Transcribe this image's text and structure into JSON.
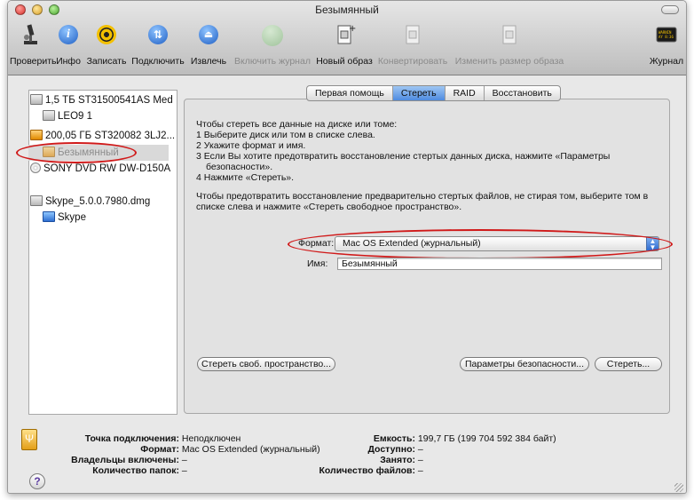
{
  "window": {
    "title": "Безымянный"
  },
  "toolbar": {
    "verify": "Проверить",
    "info": "Инфо",
    "burn": "Записать",
    "mount": "Подключить",
    "eject": "Извлечь",
    "enable_journal": "Включить журнал",
    "new_image": "Новый образ",
    "convert": "Конвертировать",
    "resize_image": "Изменить размер образа",
    "log": "Журнал"
  },
  "sidebar": {
    "items": [
      {
        "label": "1,5 ТБ ST31500541AS Med"
      },
      {
        "label": "LEO9 1"
      },
      {
        "label": "200,05 ГБ ST320082 3LJ2..."
      },
      {
        "label": "Безымянный"
      },
      {
        "label": "SONY DVD RW DW-D150A"
      },
      {
        "label": "Skype_5.0.0.7980.dmg"
      },
      {
        "label": "Skype"
      }
    ]
  },
  "tabs": [
    "Первая помощь",
    "Стереть",
    "RAID",
    "Восстановить"
  ],
  "instructions": {
    "line1": "Чтобы стереть все данные на диске или томе:",
    "line2": "1  Выберите диск или том в списке слева.",
    "line3": "2  Укажите формат и имя.",
    "line4": "3  Если Вы хотите предотвратить восстановление стертых данных диска, нажмите «Параметры",
    "line5": "безопасности».",
    "line6": "4  Нажмите «Стереть».",
    "para2_line1": "Чтобы предотвратить восстановление предварительно стертых файлов, не стирая том, выберите том в",
    "para2_line2": "списке слева и нажмите «Стереть свободное пространство»."
  },
  "form": {
    "format_label": "Формат:",
    "format_value": "Mac OS Extended (журнальный)",
    "name_label": "Имя:",
    "name_value": "Безымянный"
  },
  "buttons": {
    "erase_free": "Стереть своб. пространство...",
    "security": "Параметры безопасности...",
    "erase": "Стереть..."
  },
  "info": {
    "mount_label": "Точка подключения:",
    "mount_value": "Неподключен",
    "format_label": "Формат:",
    "format_value": "Mac OS Extended (журнальный)",
    "owners_label": "Владельцы включены:",
    "owners_value": "–",
    "folders_label": "Количество папок:",
    "folders_value": "–",
    "capacity_label": "Емкость:",
    "capacity_value": "199,7 ГБ (199 704 592 384 байт)",
    "available_label": "Доступно:",
    "available_value": "–",
    "used_label": "Занято:",
    "used_value": "–",
    "files_label": "Количество файлов:",
    "files_value": "–"
  },
  "colors": {
    "annotation": "#d01a1a",
    "selection": "#4e8be0"
  }
}
